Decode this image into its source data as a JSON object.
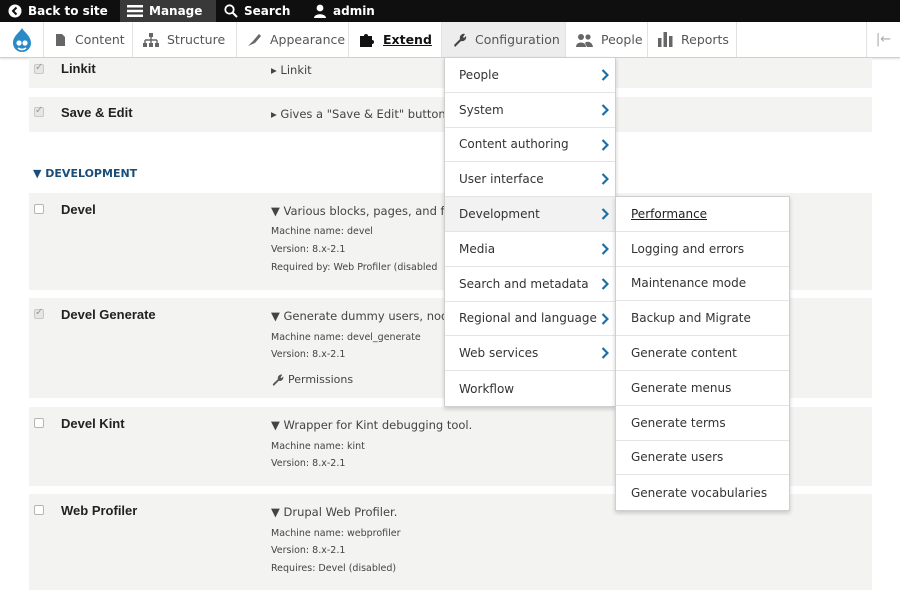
{
  "toolbar": {
    "back_to_site": "Back to site",
    "manage": "Manage",
    "search": "Search",
    "user": "admin"
  },
  "tray": {
    "items": [
      {
        "label": "Content",
        "icon": "page-icon"
      },
      {
        "label": "Structure",
        "icon": "sitemap-icon"
      },
      {
        "label": "Appearance",
        "icon": "paintbrush-icon"
      },
      {
        "label": "Extend",
        "icon": "puzzle-icon"
      },
      {
        "label": "Configuration",
        "icon": "wrench-icon"
      },
      {
        "label": "People",
        "icon": "people-icon"
      },
      {
        "label": "Reports",
        "icon": "bar-chart-icon"
      }
    ],
    "collapse": "|←"
  },
  "modules_top": [
    {
      "name": "Linkit",
      "desc": "▸ Linkit"
    },
    {
      "name": "Save & Edit",
      "desc": "▸ Gives a \"Save & Edit\" button c"
    }
  ],
  "group": "▼ DEVELOPMENT",
  "modules": [
    {
      "name": "Devel",
      "desc": "▼ Various blocks, pages, and fu",
      "machine": "Machine name: devel",
      "version": "Version: 8.x-2.1",
      "extra": "Required by: Web Profiler (disabled"
    },
    {
      "name": "Devel Generate",
      "desc": "▼ Generate dummy users, node",
      "machine": "Machine name: devel_generate",
      "version": "Version: 8.x-2.1",
      "extra": "Permissions"
    },
    {
      "name": "Devel Kint",
      "desc": "▼ Wrapper for Kint debugging tool.",
      "machine": "Machine name: kint",
      "version": "Version: 8.x-2.1"
    },
    {
      "name": "Web Profiler",
      "desc": "▼ Drupal Web Profiler.",
      "machine": "Machine name: webprofiler",
      "version": "Version: 8.x-2.1",
      "extra": "Requires: Devel (disabled)"
    }
  ],
  "config_menu": [
    "People",
    "System",
    "Content authoring",
    "User interface",
    "Development",
    "Media",
    "Search and metadata",
    "Regional and language",
    "Web services",
    "Workflow"
  ],
  "dev_submenu": [
    "Performance",
    "Logging and errors",
    "Maintenance mode",
    "Backup and Migrate",
    "Generate content",
    "Generate menus",
    "Generate terms",
    "Generate users",
    "Generate vocabularies"
  ]
}
